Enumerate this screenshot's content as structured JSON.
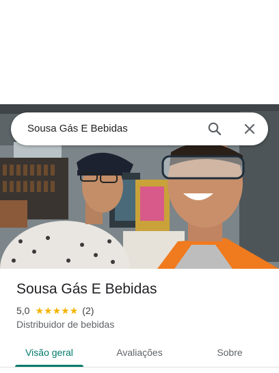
{
  "search": {
    "query": "Sousa Gás E Bebidas"
  },
  "place": {
    "name": "Sousa Gás E Bebidas",
    "rating": "5,0",
    "stars": 5,
    "review_count": "(2)",
    "category": "Distribuidor de bebidas"
  },
  "tabs": [
    {
      "label": "Visão geral",
      "active": true
    },
    {
      "label": "Avaliações",
      "active": false
    },
    {
      "label": "Sobre",
      "active": false
    }
  ],
  "colors": {
    "accent": "#00796b",
    "star": "#f4b400"
  },
  "icons": {
    "search": "search-icon",
    "close": "close-icon"
  }
}
